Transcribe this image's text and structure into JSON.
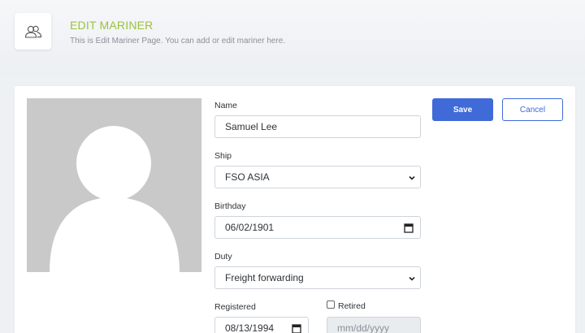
{
  "header": {
    "title": "EDIT MARINER",
    "subtitle": "This is Edit Mariner Page. You can add or edit mariner here.",
    "icon": "users-icon"
  },
  "form": {
    "name": {
      "label": "Name",
      "value": "Samuel Lee"
    },
    "ship": {
      "label": "Ship",
      "value": "FSO ASIA"
    },
    "birthday": {
      "label": "Birthday",
      "value": "06/02/1901"
    },
    "duty": {
      "label": "Duty",
      "value": "Freight forwarding"
    },
    "registered": {
      "label": "Registered",
      "value": "08/13/1994"
    },
    "retired": {
      "label": "Retired",
      "checked": false,
      "value": "",
      "placeholder": "mm/dd/yyyy"
    }
  },
  "actions": {
    "save_label": "Save",
    "cancel_label": "Cancel"
  },
  "colors": {
    "accent": "#3f6ad8",
    "title": "#9cc23c",
    "avatar_bg": "#c9c9c9"
  }
}
